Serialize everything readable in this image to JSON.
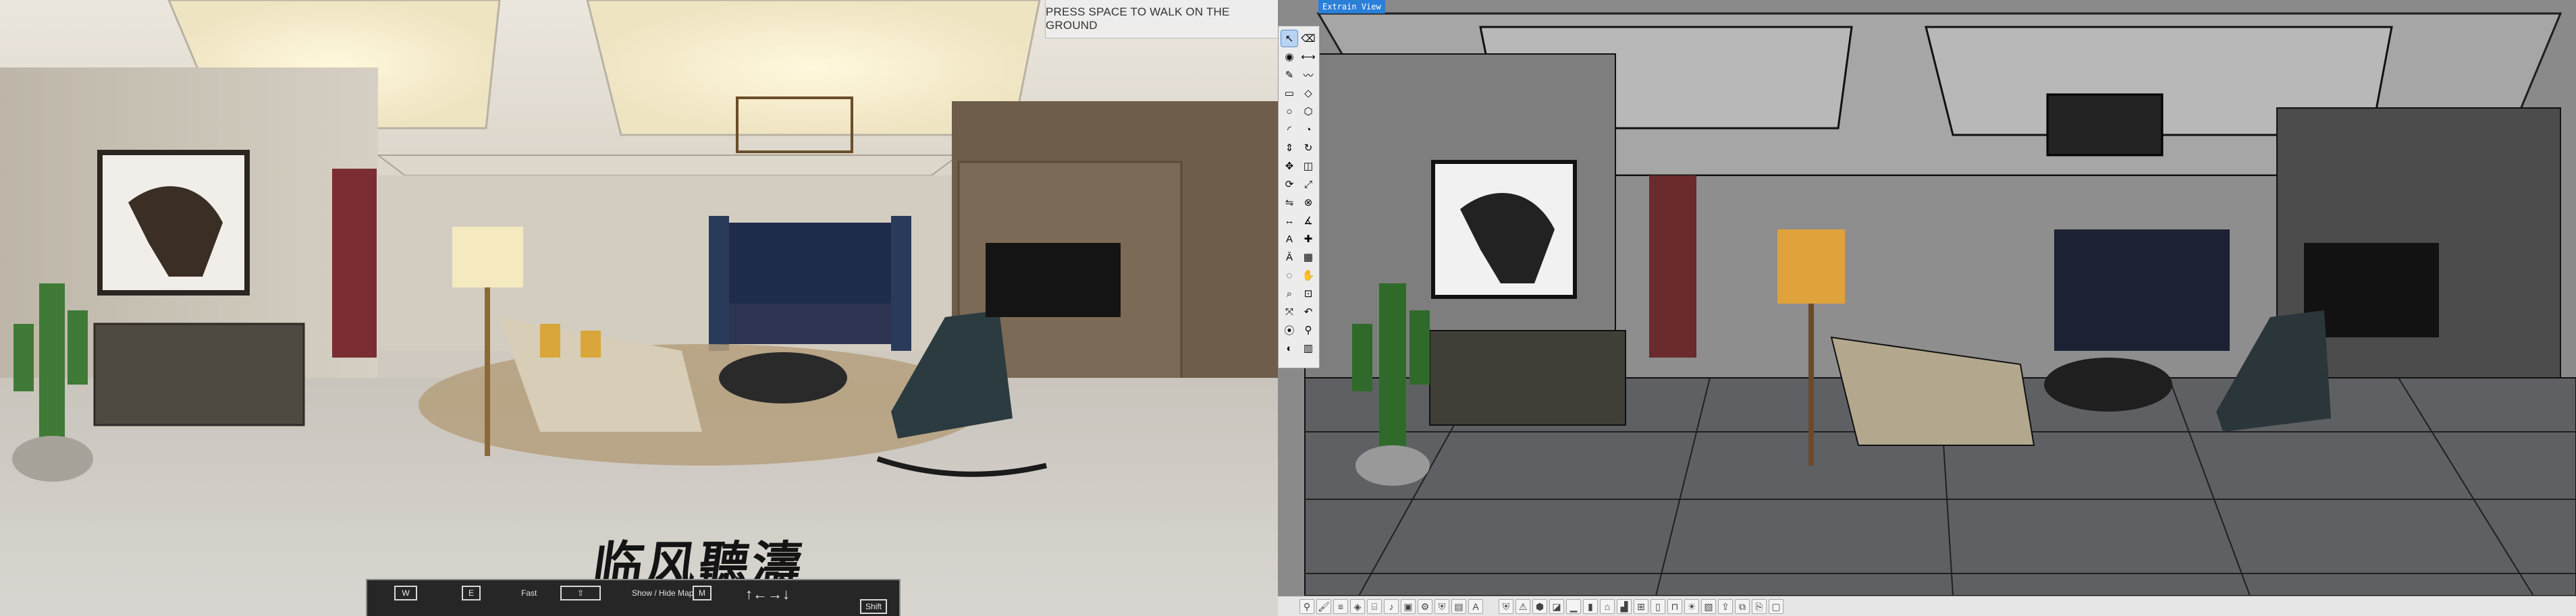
{
  "left_view": {
    "hint_text": "PRESS SPACE TO WALK ON THE GROUND",
    "calligraphy": "临风聽濤",
    "walk_controls": {
      "keys": [
        "W",
        "E",
        "⇧",
        "M",
        "Shift"
      ],
      "speed_label": "Fast",
      "map_label": "Show / Hide Map"
    }
  },
  "right_view": {
    "view_label": "Extrain View",
    "tool_icons": [
      "select-icon",
      "eraser-icon",
      "paint-bucket-icon",
      "tape-icon",
      "pencil-icon",
      "freehand-icon",
      "rectangle-icon",
      "rotated-rect-icon",
      "circle-icon",
      "polygon-icon",
      "arc-icon",
      "pie-icon",
      "push-pull-icon",
      "follow-me-icon",
      "move-icon",
      "offset-icon",
      "rotate-icon",
      "scale-icon",
      "flip-icon",
      "intersect-icon",
      "dimension-icon",
      "protractor-icon",
      "text-icon",
      "axes-icon",
      "3d-text-icon",
      "section-icon",
      "orbit-icon",
      "pan-icon",
      "zoom-icon",
      "zoom-window-icon",
      "zoom-extents-icon",
      "previous-view-icon",
      "position-camera-icon",
      "walk-icon",
      "look-around-icon",
      "section-fill-icon"
    ],
    "bottom_icons": [
      "walk-icon",
      "paint-icon",
      "layer-icon",
      "render-icon",
      "camera-icon",
      "speaker-icon",
      "scene-icon",
      "gear-icon",
      "shield-icon",
      "grid-icon",
      "text-icon",
      "shield-icon",
      "warning-icon",
      "component-icon",
      "material-icon",
      "floor-icon",
      "wall-icon",
      "roof-icon",
      "stair-icon",
      "window-icon",
      "door-icon",
      "furniture-icon",
      "light-icon",
      "image-icon",
      "export-icon",
      "copy-icon",
      "paste-icon",
      "frame-icon"
    ]
  },
  "colors": {
    "accent": "#2a7fd8",
    "hint_bg": "#eeeeee",
    "toolbar_bg": "#ececec"
  }
}
